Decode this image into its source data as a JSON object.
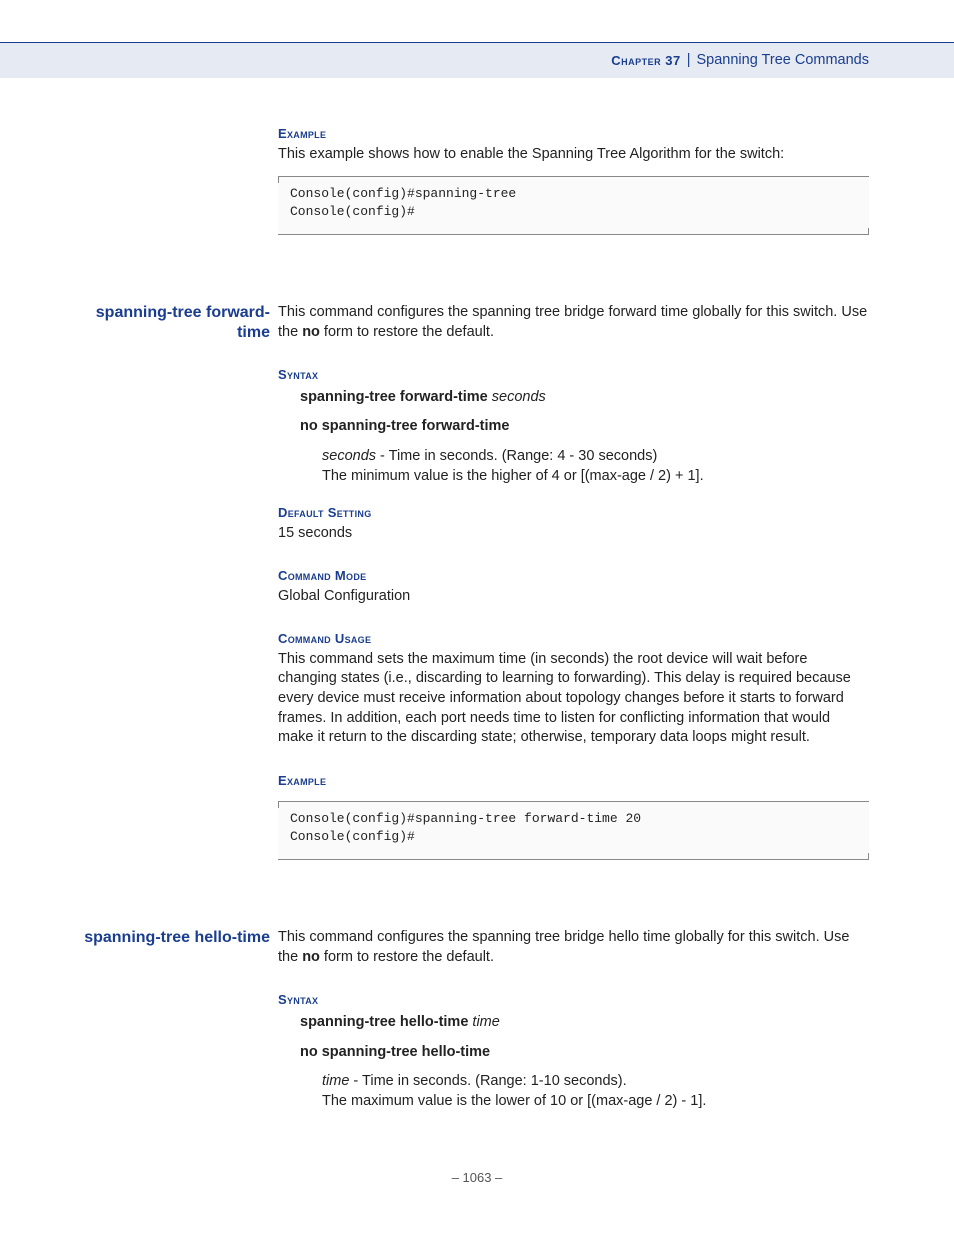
{
  "header": {
    "chapter_label": "Chapter 37",
    "separator": "|",
    "title": "Spanning Tree Commands"
  },
  "section1": {
    "example_label": "Example",
    "example_intro": "This example shows how to enable the Spanning Tree Algorithm for the switch:",
    "code": "Console(config)#spanning-tree\nConsole(config)#"
  },
  "section2": {
    "side_title": "spanning-tree forward-time",
    "intro_a": "This command configures the spanning tree bridge forward time globally for this switch. Use the ",
    "intro_no": "no",
    "intro_b": " form to restore the default.",
    "syntax_label": "Syntax",
    "syntax_cmd_bold": "spanning-tree forward-time",
    "syntax_cmd_ital": "seconds",
    "syntax_no": "no spanning-tree forward-time",
    "param_name": "seconds",
    "param_desc1": " - Time in seconds. (Range: 4 - 30 seconds)",
    "param_desc2": "The minimum value is the higher of 4 or [(max-age / 2) + 1].",
    "default_label": "Default Setting",
    "default_value": "15 seconds",
    "mode_label": "Command Mode",
    "mode_value": "Global Configuration",
    "usage_label": "Command Usage",
    "usage_text": "This command sets the maximum time (in seconds) the root device will wait before changing states (i.e., discarding to learning to forwarding). This delay is required because every device must receive information about topology changes before it starts to forward frames. In addition, each port needs time to listen for conflicting information that would make it return to the discarding state; otherwise, temporary data loops might result.",
    "example_label": "Example",
    "code": "Console(config)#spanning-tree forward-time 20\nConsole(config)#"
  },
  "section3": {
    "side_title": "spanning-tree hello-time",
    "intro_a": "This command configures the spanning tree bridge hello time globally for this switch. Use the ",
    "intro_no": "no",
    "intro_b": " form to restore the default.",
    "syntax_label": "Syntax",
    "syntax_cmd_bold": "spanning-tree hello-time",
    "syntax_cmd_ital": "time",
    "syntax_no": "no spanning-tree hello-time",
    "param_name": "time",
    "param_desc1": " - Time in seconds. (Range: 1-10 seconds).",
    "param_desc2": "The maximum value is the lower of 10 or [(max-age / 2) - 1]."
  },
  "footer": {
    "page": "–  1063  –"
  }
}
